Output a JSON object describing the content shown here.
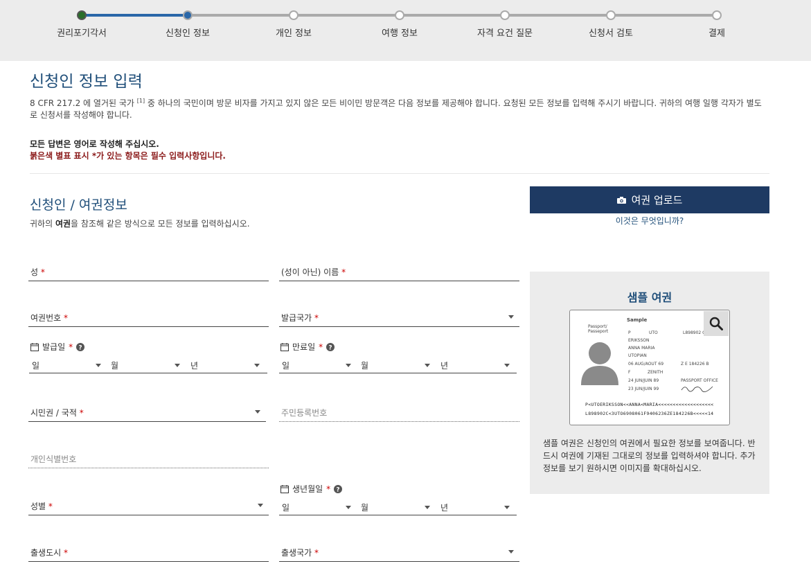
{
  "progress": {
    "steps": [
      {
        "label": "권리포기각서",
        "state": "done"
      },
      {
        "label": "신청인 정보",
        "state": "current"
      },
      {
        "label": "개인 정보",
        "state": "todo"
      },
      {
        "label": "여행 정보",
        "state": "todo"
      },
      {
        "label": "자격 요건 질문",
        "state": "todo"
      },
      {
        "label": "신청서 검토",
        "state": "todo"
      },
      {
        "label": "결제",
        "state": "todo"
      }
    ],
    "active_color": "#2a67a8"
  },
  "page": {
    "title": "신청인 정보 입력",
    "intro_part1": "8 CFR 217.2 에 열거된 국가 ",
    "intro_ref": "[1]",
    "intro_part2": " 중 하나의 국민이며 방문 비자를 가지고 있지 않은 모든 비이민 방문객은 다음 정보를 제공해야 합니다. 요청된 모든 정보를 입력해 주시기 바랍니다. 귀하의 여행 일행 각자가 별도로 신청서를 작성해야 합니다.",
    "notice_english": "모든 답변은 영어로 작성해 주십시오.",
    "notice_required": "붉은색 별표 표시 *가 있는 항목은 필수 입력사항입니다."
  },
  "section": {
    "title": "신청인 / 여권정보",
    "sub_pre": "귀하의 ",
    "sub_bold": "여권",
    "sub_post": "을 참조해 같은 방식으로 모든 정보를 입력하십시오."
  },
  "upload": {
    "button_label": "여권 업로드",
    "help_link": "이것은 무엇입니까?",
    "button_color": "#1e3a63"
  },
  "form": {
    "surname": "성",
    "given_name": "(성이 아닌) 이름",
    "passport_number": "여권번호",
    "issuing_country": "발급국가",
    "issue_date": "발급일",
    "expiry_date": "만료일",
    "day": "일",
    "month": "월",
    "year": "년",
    "citizenship": "시민권 / 국적",
    "national_id": "주민등록번호",
    "personal_id": "개인식별번호",
    "gender": "성별",
    "birth_date": "생년월일",
    "birth_city": "출생도시",
    "birth_country": "출생국가",
    "required_mark": "*"
  },
  "sample": {
    "title": "샘플 여권",
    "description": "샘플 여권은 신청인의 여권에서 필요한 정보를 보여줍니다. 반드시 여권에 기재된 그대로의 정보를 입력하셔야 합니다. 추가 정보를 보기 원하시면 이미지를 확대하십시오.",
    "passport": {
      "sample_label": "Sample",
      "doc_type": "Passport/ Passeport",
      "type_value": "P",
      "code_value": "UTO",
      "number_value": "L898902 C",
      "surname_value": "ERIKSSON",
      "given_value": "ANNA MARIA",
      "nationality_value": "UTOPIAN",
      "dob_value": "06 AUG/AOUT 69",
      "personal_no_value": "Z E 184226 B",
      "sex_value": "F",
      "birthplace_value": "ZENITH",
      "issue_value": "24 JUN/JUIN 89",
      "authority_value": "PASSPORT OFFICE",
      "expiry_value": "23 JUN/JUIN 99",
      "mrz1": "P<UTOERIKSSON<<ANNA<MARIA<<<<<<<<<<<<<<<<<<<",
      "mrz2": "L898902C<3UTO6908061F9406236ZE184226B<<<<<14"
    }
  }
}
